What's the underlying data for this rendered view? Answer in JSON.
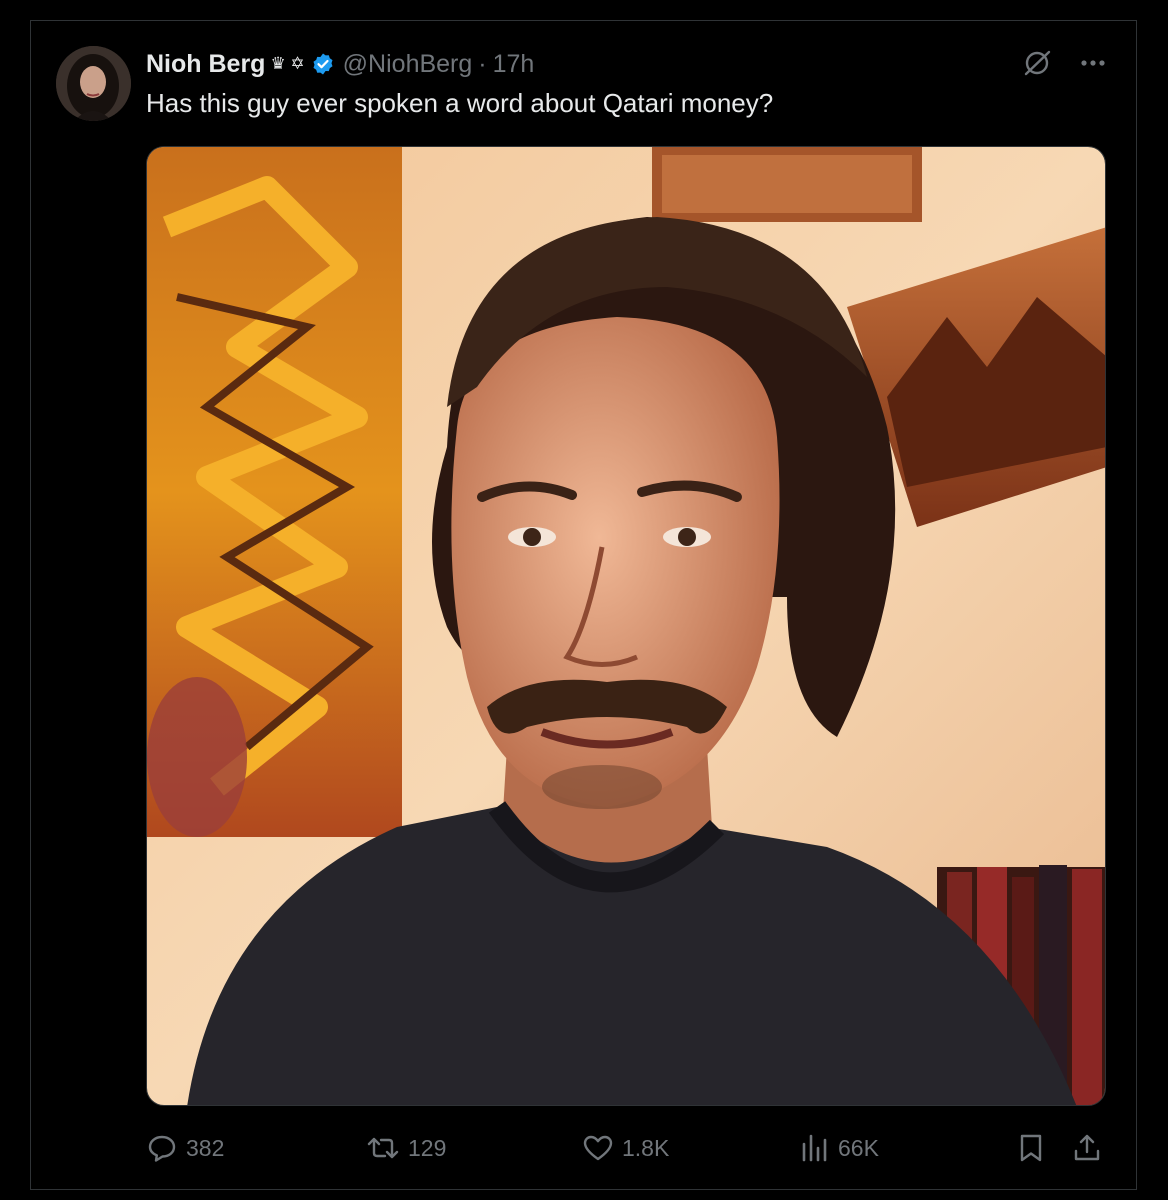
{
  "tweet": {
    "display_name": "Nioh Berg",
    "badge_glyphs": "♛ ✡",
    "handle": "@NiohBerg",
    "separator": "·",
    "time": "17h",
    "text": "Has this guy ever spoken a word about Qatari money?"
  },
  "actions": {
    "replies": "382",
    "reposts": "129",
    "likes": "1.8K",
    "views": "66K"
  },
  "icons": {
    "verified": "verified-check-icon",
    "grok": "grok-icon",
    "more": "more-icon",
    "reply": "reply-icon",
    "repost": "repost-icon",
    "like": "heart-icon",
    "views": "views-chart-icon",
    "bookmark": "bookmark-icon",
    "share": "share-icon"
  },
  "colors": {
    "background": "#000000",
    "text_primary": "#e7e9ea",
    "text_secondary": "#71767b",
    "verified_blue": "#1d9bf0",
    "border": "#2f3336"
  }
}
